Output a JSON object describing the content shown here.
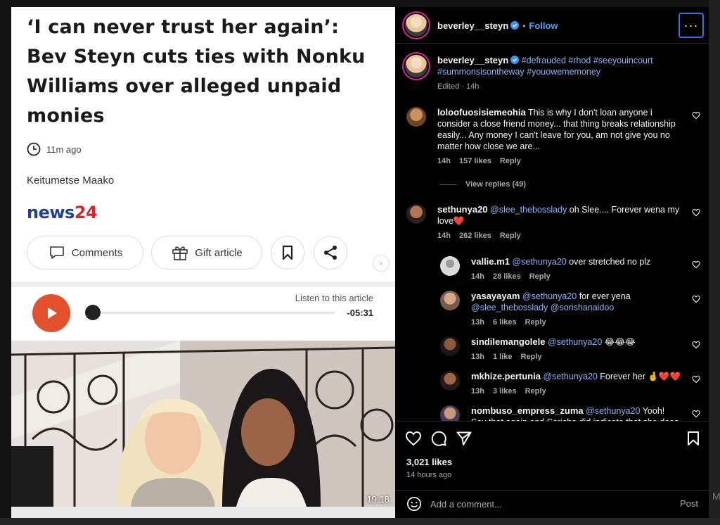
{
  "article": {
    "headline": "‘I can never trust her again’: Bev Steyn cuts ties with Nonku Williams over alleged unpaid monies",
    "time_ago": "11m ago",
    "author": "Keitumetse Maako",
    "brand_news": "news",
    "brand_num": "24",
    "comments_label": "Comments",
    "gift_label": "Gift article",
    "listen_label": "Listen to this article",
    "remaining": "-05:31",
    "video_time": "19:18"
  },
  "post": {
    "username": "beverley__steyn",
    "follow_label": "Follow",
    "more_label": "···",
    "caption_tags": "#defrauded #rhod #seeyouincourt #summonsisontheway #youowememoney",
    "edited": "Edited · 14h",
    "likes": "3,021 likes",
    "posted": "14 hours ago"
  },
  "comments": [
    {
      "user": "loloofuosisiemeohia",
      "text": "This is why I don't loan anyone i consider a close friend money... that thing breaks relationship easily... Any money I can't leave for you, am not give you no matter how close we are...",
      "age": "14h",
      "likes": "157 likes",
      "reply": "Reply"
    },
    {
      "user": "sethunya20",
      "mention": "@slee_thebosslady",
      "text": " oh Slee.... Forever wena my love❤️",
      "age": "14h",
      "likes": "262 likes",
      "reply": "Reply"
    }
  ],
  "view_replies": "View replies (49)",
  "replies": [
    {
      "user": "vallie.m1",
      "mention": "@sethunya20",
      "text": " over stretched no plz",
      "age": "14h",
      "likes": "28 likes",
      "reply": "Reply"
    },
    {
      "user": "yasayayam",
      "mention": "@sethunya20",
      "text": " for ever yena",
      "mention2": "@slee_thebosslady @sorishanaidoo",
      "age": "13h",
      "likes": "6 likes",
      "reply": "Reply"
    },
    {
      "user": "sindilemangolele",
      "mention": "@sethunya20",
      "text": " 😂😂😂",
      "age": "13h",
      "likes": "1 like",
      "reply": "Reply"
    },
    {
      "user": "mkhize.pertunia",
      "mention": "@sethunya20",
      "text": " Forever her 🤞❤️❤️",
      "age": "13h",
      "likes": "3 likes",
      "reply": "Reply"
    },
    {
      "user": "nombuso_empress_zuma",
      "mention": "@sethunya20",
      "text": " Yooh! Say that again and Sorisha did indicate that she does"
    }
  ],
  "add_comment_placeholder": "Add a comment...",
  "post_label": "Post",
  "backdrop_letter": "M",
  "colors": {
    "accent": "#4fa3f7",
    "tag": "#8ab4f8",
    "play": "#e2502d",
    "brand_blue": "#233f8f",
    "brand_red": "#d9232e"
  },
  "icons": [
    "clock-icon",
    "comment-bubble-icon",
    "gift-icon",
    "bookmark-icon",
    "share-icon",
    "play-icon",
    "verified-icon",
    "heart-icon",
    "comment-icon",
    "send-icon",
    "save-icon",
    "emoji-icon"
  ]
}
